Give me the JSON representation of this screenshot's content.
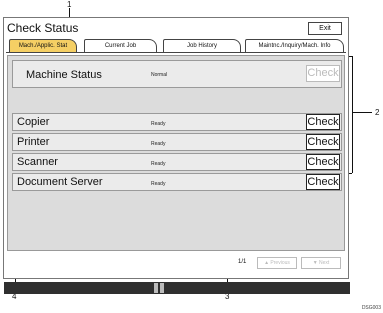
{
  "callouts": {
    "c1": "1",
    "c2": "2",
    "c3": "3",
    "c4": "4"
  },
  "title": "Check Status",
  "exit_label": "Exit",
  "tabs": [
    {
      "label": "Mach./Applic. Stat",
      "active": true
    },
    {
      "label": "Current Job",
      "active": false
    },
    {
      "label": "Job History",
      "active": false
    },
    {
      "label": "Maintnc./Inquiry/Mach. Info",
      "active": false
    }
  ],
  "rows": [
    {
      "name": "Machine Status",
      "status": "Normal",
      "check": "Check",
      "check_enabled": false
    },
    {
      "name": "Copier",
      "status": "Ready",
      "check": "Check",
      "check_enabled": true
    },
    {
      "name": "Printer",
      "status": "Ready",
      "check": "Check",
      "check_enabled": true
    },
    {
      "name": "Scanner",
      "status": "Ready",
      "check": "Check",
      "check_enabled": true
    },
    {
      "name": "Document Server",
      "status": "Ready",
      "check": "Check",
      "check_enabled": true
    }
  ],
  "pager": {
    "page": "1/1",
    "prev": "▲ Previous",
    "next": "▼ Next"
  },
  "figure_code": "DSG003"
}
